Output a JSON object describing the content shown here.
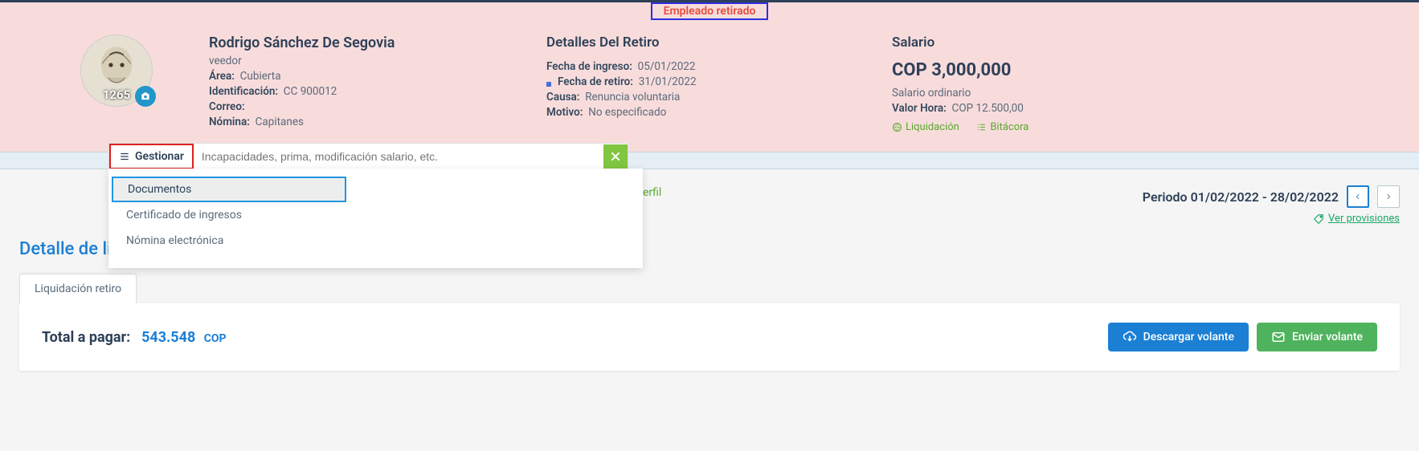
{
  "status_banner": "Empleado retirado",
  "employee": {
    "id": "1265",
    "name": "Rodrigo Sánchez De Segovia",
    "role": "veedor",
    "area_label": "Área:",
    "area_value": "Cubierta",
    "ident_label": "Identificación:",
    "ident_value": "CC 900012",
    "email_label": "Correo:",
    "email_value": "",
    "nomina_label": "Nómina:",
    "nomina_value": "Capitanes"
  },
  "retire": {
    "title": "Detalles Del Retiro",
    "ingreso_label": "Fecha de ingreso:",
    "ingreso_value": "05/01/2022",
    "retiro_label": "Fecha de retiro:",
    "retiro_value": "31/01/2022",
    "causa_label": "Causa:",
    "causa_value": "Renuncia voluntaria",
    "motivo_label": "Motivo:",
    "motivo_value": "No especificado"
  },
  "salary": {
    "title": "Salario",
    "amount": "COP 3,000,000",
    "type": "Salario ordinario",
    "hour_label": "Valor Hora:",
    "hour_value": "COP 12.500,00",
    "link_liq": "Liquidación",
    "link_bit": "Bitácora"
  },
  "gestionar": {
    "button": "Gestionar",
    "placeholder": "Incapacidades, prima, modificación salario, etc."
  },
  "dropdown": {
    "documentos": "Documentos",
    "certificado": "Certificado de ingresos",
    "nomina_elec": "Nómina electrónica"
  },
  "perfil_tab": "erfil",
  "period": {
    "text": "Periodo 01/02/2022 - 28/02/2022"
  },
  "provisiones_link": "Ver provisiones",
  "detail_title": "Detalle de li",
  "tab_label": "Liquidación retiro",
  "total": {
    "label": "Total a pagar:",
    "value": "543.548",
    "currency": "COP"
  },
  "buttons": {
    "download": "Descargar volante",
    "send": "Enviar volante"
  }
}
